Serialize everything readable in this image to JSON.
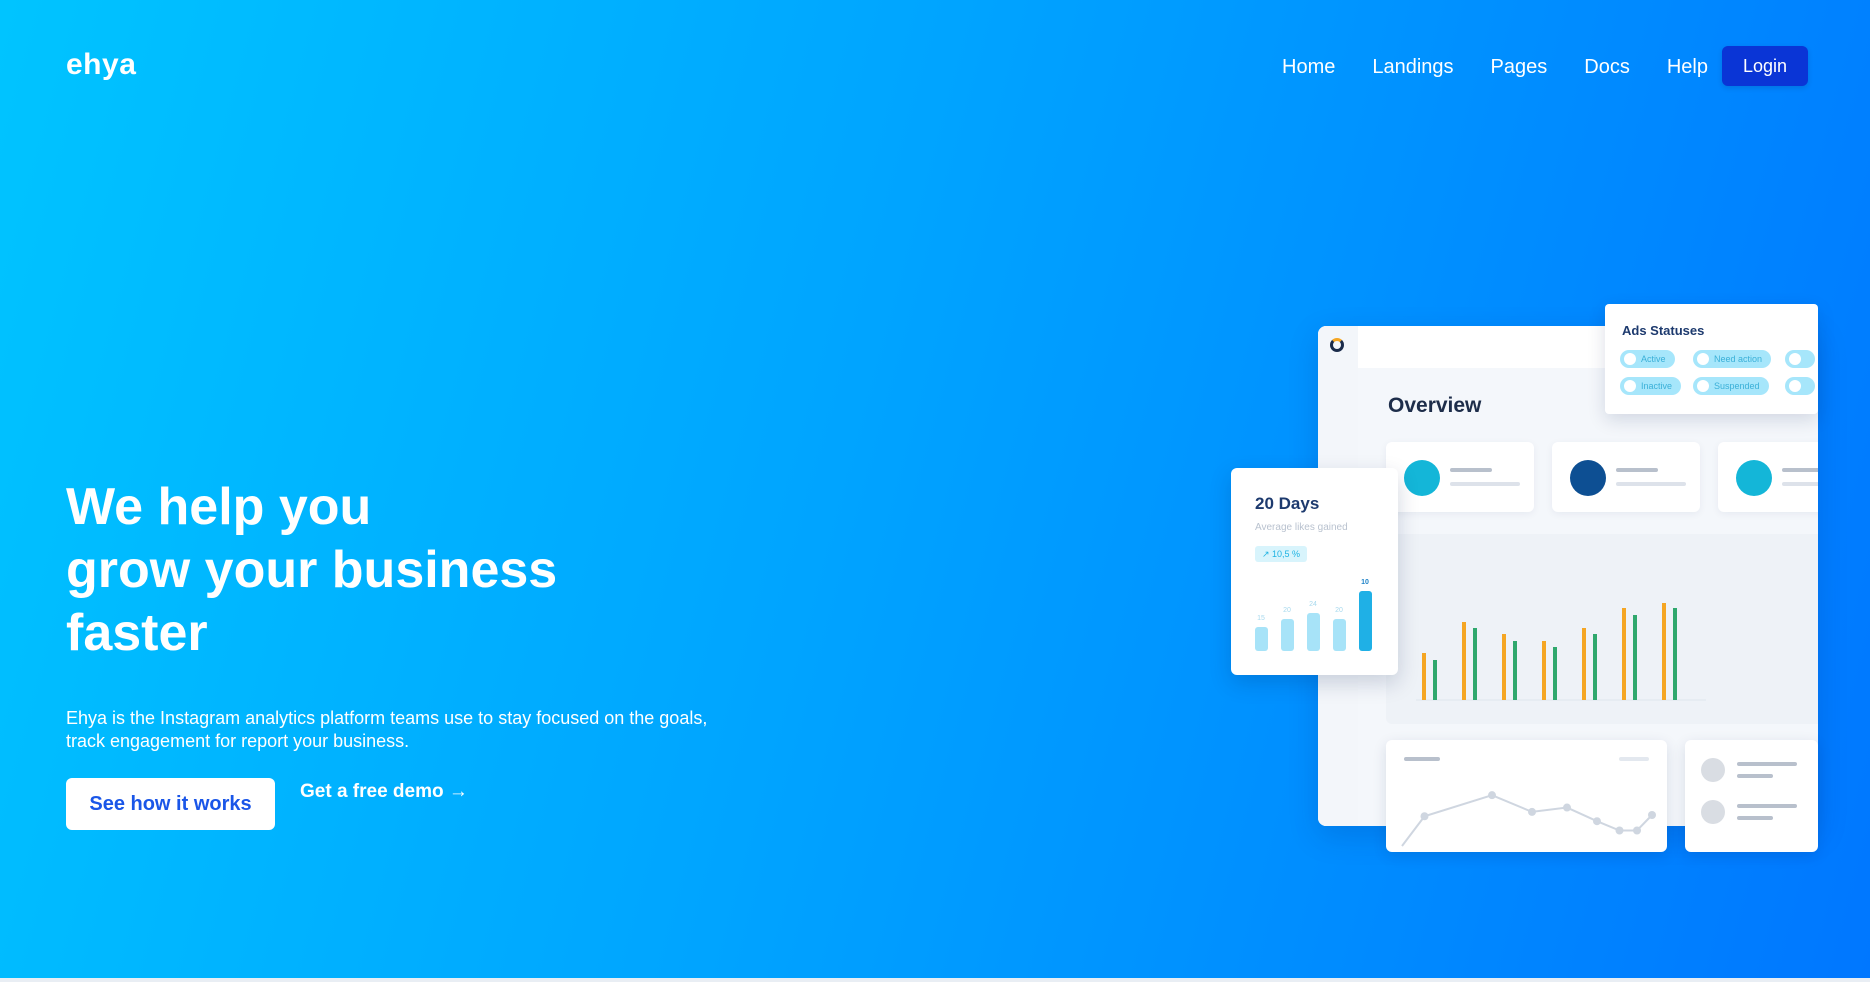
{
  "brand": {
    "logo": "ehya"
  },
  "nav": {
    "items": [
      "Home",
      "Landings",
      "Pages",
      "Docs",
      "Help"
    ],
    "login_label": "Login"
  },
  "hero": {
    "headline": [
      "We help you",
      "grow your business",
      "faster"
    ],
    "subtext": [
      "Ehya is the Instagram analytics platform teams use to stay focused on the goals,",
      "track engagement for report your business."
    ],
    "primary_cta": "See how it works",
    "secondary_cta": "Get a free demo →"
  },
  "dashboard": {
    "overview_title": "Overview",
    "stat_dot_colors": [
      "#14b6d8",
      "#0d4f93",
      "#14b6d8"
    ],
    "ads_statuses": {
      "title": "Ads Statuses",
      "chips_row1": [
        "Active",
        "Need action",
        ""
      ],
      "chips_row2": [
        "Inactive",
        "Suspended",
        ""
      ]
    },
    "days_card": {
      "title": "20 Days",
      "subtitle": "Average likes gained",
      "badge": "↗ 10,5 %",
      "bars": [
        {
          "label": "15",
          "value": 15
        },
        {
          "label": "20",
          "value": 20
        },
        {
          "label": "24",
          "value": 24
        },
        {
          "label": "20",
          "value": 20
        },
        {
          "label": "10",
          "value": 38,
          "highlight": true
        }
      ]
    },
    "main_chart_pairs": [
      {
        "orange": 0.47,
        "green": 0.4
      },
      {
        "orange": 0.78,
        "green": 0.72
      },
      {
        "orange": 0.66,
        "green": 0.59
      },
      {
        "orange": 0.59,
        "green": 0.53
      },
      {
        "orange": 0.72,
        "green": 0.66
      },
      {
        "orange": 0.92,
        "green": 0.85
      },
      {
        "orange": 0.97,
        "green": 0.92
      }
    ],
    "line_points": [
      0.0,
      0.48,
      0.82,
      0.55,
      0.62,
      0.4,
      0.25,
      0.25,
      0.5
    ],
    "colors": {
      "orange": "#f5a623",
      "green": "#2fa86d",
      "line": "#cfd6e0"
    }
  }
}
